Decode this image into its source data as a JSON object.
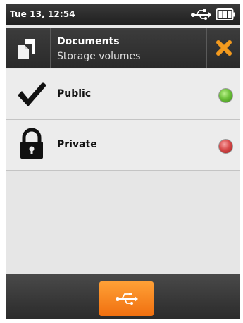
{
  "status_bar": {
    "time": "Tue 13, 12:54",
    "usb_icon": "usb-icon",
    "battery_icon": "battery-icon"
  },
  "header": {
    "icon": "documents-icon",
    "title": "Documents",
    "subtitle": "Storage volumes",
    "close_icon": "close-icon"
  },
  "volumes": [
    {
      "label": "Public",
      "icon": "checkmark-icon",
      "status_color": "#5cb832"
    },
    {
      "label": "Private",
      "icon": "lock-icon",
      "status_color": "#d03c3c"
    }
  ],
  "bottom_bar": {
    "usb_button_icon": "usb-icon",
    "accent": "#f58220"
  }
}
